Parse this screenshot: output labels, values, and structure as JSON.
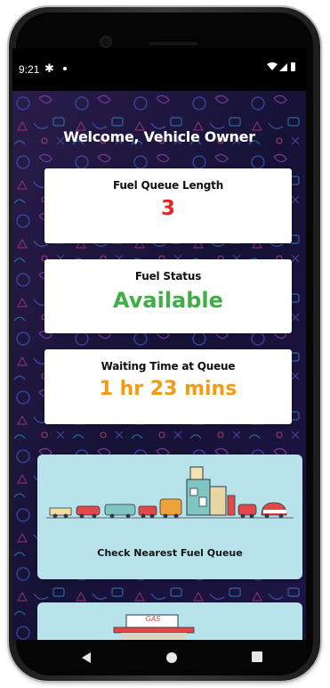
{
  "status_bar": {
    "time": "9:21",
    "icons": [
      "settings-gear-icon",
      "notification-dot-icon",
      "wifi-icon",
      "signal-icon",
      "battery-icon"
    ]
  },
  "app": {
    "welcome_text": "Welcome, Vehicle Owner",
    "cards": [
      {
        "label": "Fuel Queue Length",
        "value": "3",
        "value_color": "#e52424"
      },
      {
        "label": "Fuel Status",
        "value": "Available",
        "value_color": "#3fae49"
      },
      {
        "label": "Waiting Time at Queue",
        "value": "1 hr 23 mins",
        "value_color": "#f59b12"
      }
    ],
    "tiles": [
      {
        "label": "Check Nearest Fuel Queue",
        "illustration": "cars-queue-at-fuel-station"
      },
      {
        "label": "",
        "illustration": "gas-station-sign",
        "sign_text": "GAS"
      }
    ],
    "colors": {
      "background": "#1a1438",
      "tile_background": "#b9e3ea"
    }
  },
  "nav_bar": {
    "icons": [
      "back-icon",
      "home-icon",
      "recents-icon"
    ]
  }
}
